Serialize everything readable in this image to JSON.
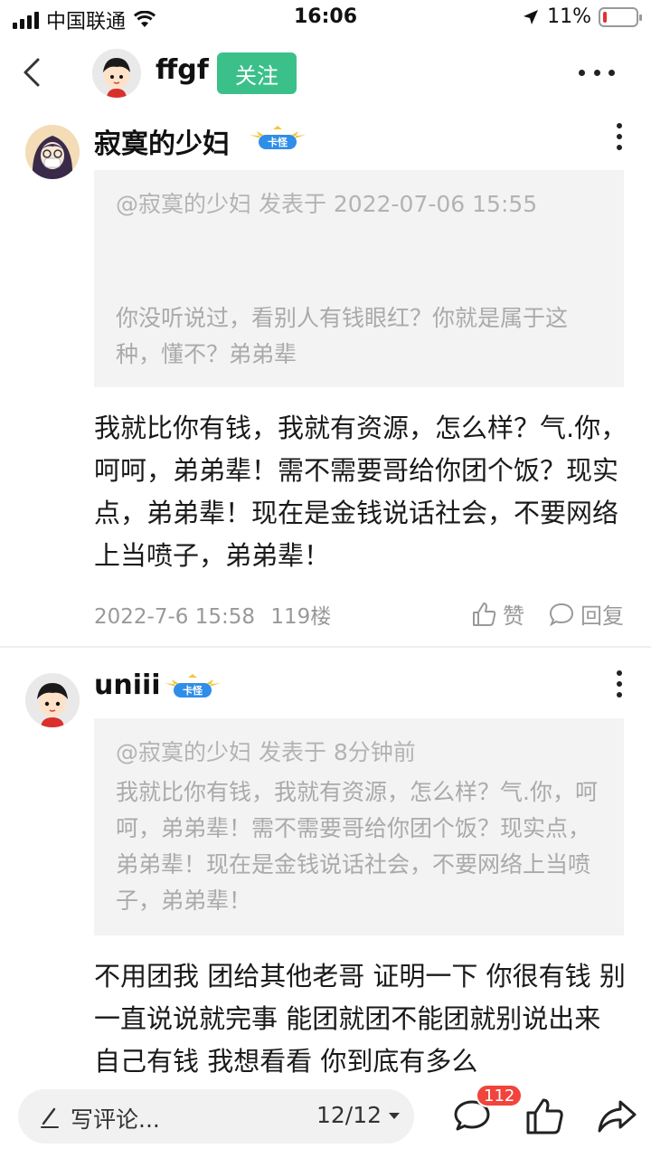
{
  "status_bar": {
    "carrier": "中国联通",
    "time": "16:06",
    "battery": "11%",
    "battery_level": 0.11
  },
  "header": {
    "author_name": "ffgf",
    "follow_label": "关注"
  },
  "posts": [
    {
      "username": "寂寞的少妇",
      "badge_text": "卡怪",
      "quote_meta": "@寂寞的少妇 发表于 2022-07-06 15:55",
      "quote_text": "你没听说过，看别人有钱眼红？你就是属于这种，懂不？弟弟辈",
      "content": "我就比你有钱，我就有资源，怎么样？气.你，呵呵，弟弟辈！需不需要哥给你团个饭？现实点，弟弟辈！现在是金钱说话社会，不要网络上当喷子，弟弟辈！",
      "timestamp": "2022-7-6 15:58",
      "floor": "119楼",
      "like_label": "赞",
      "reply_label": "回复"
    },
    {
      "username": "uniii",
      "badge_text": "卡怪",
      "quote_meta": "@寂寞的少妇 发表于 8分钟前",
      "quote_text": "我就比你有钱，我就有资源，怎么样？气.你，呵呵，弟弟辈！需不需要哥给你团个饭？现实点，弟弟辈！现在是金钱说话社会，不要网络上当喷子，弟弟辈！",
      "content": "不用团我 团给其他老哥 证明一下 你很有钱 别一直说说就完事 能团就团不能团就别说出来 自己有钱  我想看看 你到底有多么"
    }
  ],
  "bottom_bar": {
    "comment_placeholder": "写评论...",
    "page_indicator": "12/12",
    "comment_count": "112"
  },
  "colors": {
    "follow_green": "#3cc08a",
    "badge_red": "#f0443c",
    "battery_red": "#e0312f"
  }
}
